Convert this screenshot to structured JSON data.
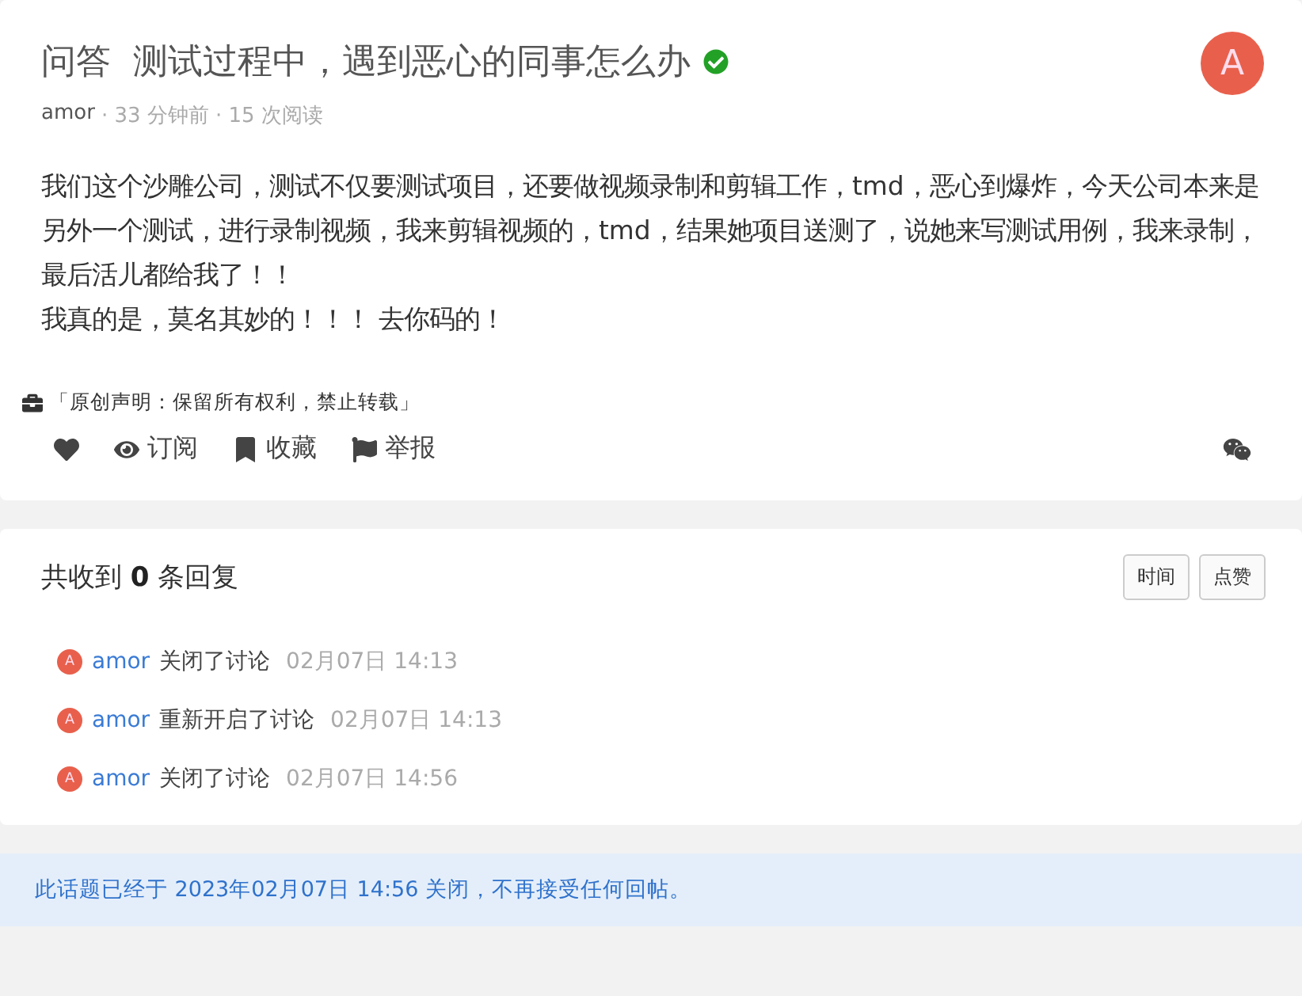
{
  "topic": {
    "node": "问答",
    "title": "测试过程中，遇到恶心的同事怎么办",
    "verified": true,
    "avatar_letter": "A",
    "author": "amor",
    "meta": "· 33 分钟前 · 15 次阅读",
    "body": [
      "我们这个沙雕公司，测试不仅要测试项目，还要做视频录制和剪辑工作，tmd，恶心到爆炸，今天公司本来是另外一个测试，进行录制视频，我来剪辑视频的，tmd，结果她项目送测了，说她来写测试用例，我来录制，最后活儿都给我了！！",
      "我真的是，莫名其妙的！！！ 去你码的！"
    ],
    "notice": "「原创声明：保留所有权利，禁止转载」",
    "actions": [
      {
        "kind": "like"
      },
      {
        "kind": "watch",
        "label": "订阅"
      },
      {
        "kind": "bookmark",
        "label": "收藏"
      },
      {
        "kind": "report",
        "label": "举报"
      }
    ]
  },
  "replies": {
    "heading": "共收到 **0** 条回复",
    "sort_buttons": [
      "时间",
      "点赞"
    ],
    "events": [
      {
        "avatar_letter": "A",
        "user": "amor",
        "action": "关闭了讨论",
        "time": "02月07日 14:13"
      },
      {
        "avatar_letter": "A",
        "user": "amor",
        "action": "重新开启了讨论",
        "time": "02月07日 14:13"
      },
      {
        "avatar_letter": "A",
        "user": "amor",
        "action": "关闭了讨论",
        "time": "02月07日 14:56"
      }
    ]
  },
  "closed_notice": "此话题已经于 2023年02月07日 14:56 关闭，不再接受任何回帖。"
}
